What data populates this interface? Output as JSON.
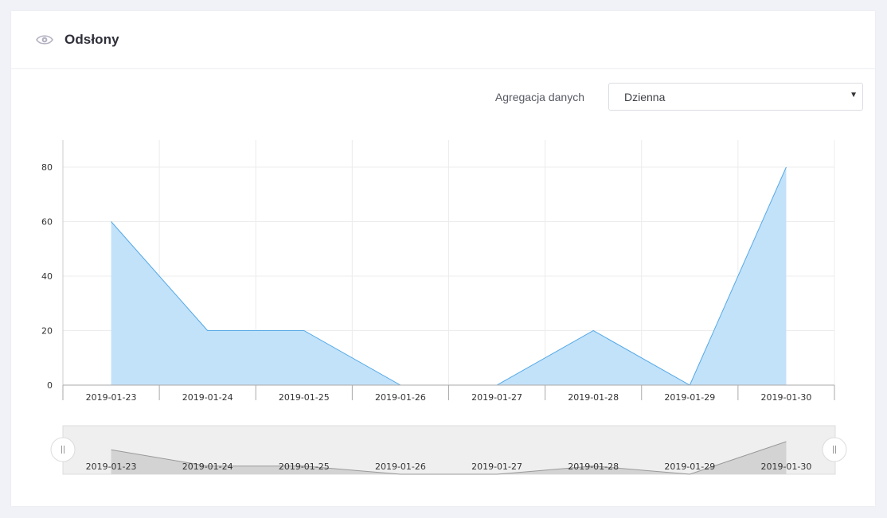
{
  "header": {
    "title": "Odsłony",
    "icon": "eye-icon"
  },
  "toolbar": {
    "label": "Agregacja danych",
    "select_value": "Dzienna"
  },
  "colors": {
    "area_fill": "#c2e2fa",
    "area_stroke": "#55a9e6",
    "nav_fill": "#d3d3d3",
    "nav_stroke": "#9a9a9a"
  },
  "chart_data": {
    "type": "area",
    "x": [
      "2019-01-23",
      "2019-01-24",
      "2019-01-25",
      "2019-01-26",
      "2019-01-27",
      "2019-01-28",
      "2019-01-29",
      "2019-01-30"
    ],
    "series": [
      {
        "values": [
          60,
          20,
          20,
          0,
          0,
          20,
          0,
          80
        ]
      }
    ],
    "yticks": [
      0,
      20,
      40,
      60,
      80
    ],
    "ylim": [
      0,
      90
    ],
    "grid": true,
    "navigator": true
  }
}
